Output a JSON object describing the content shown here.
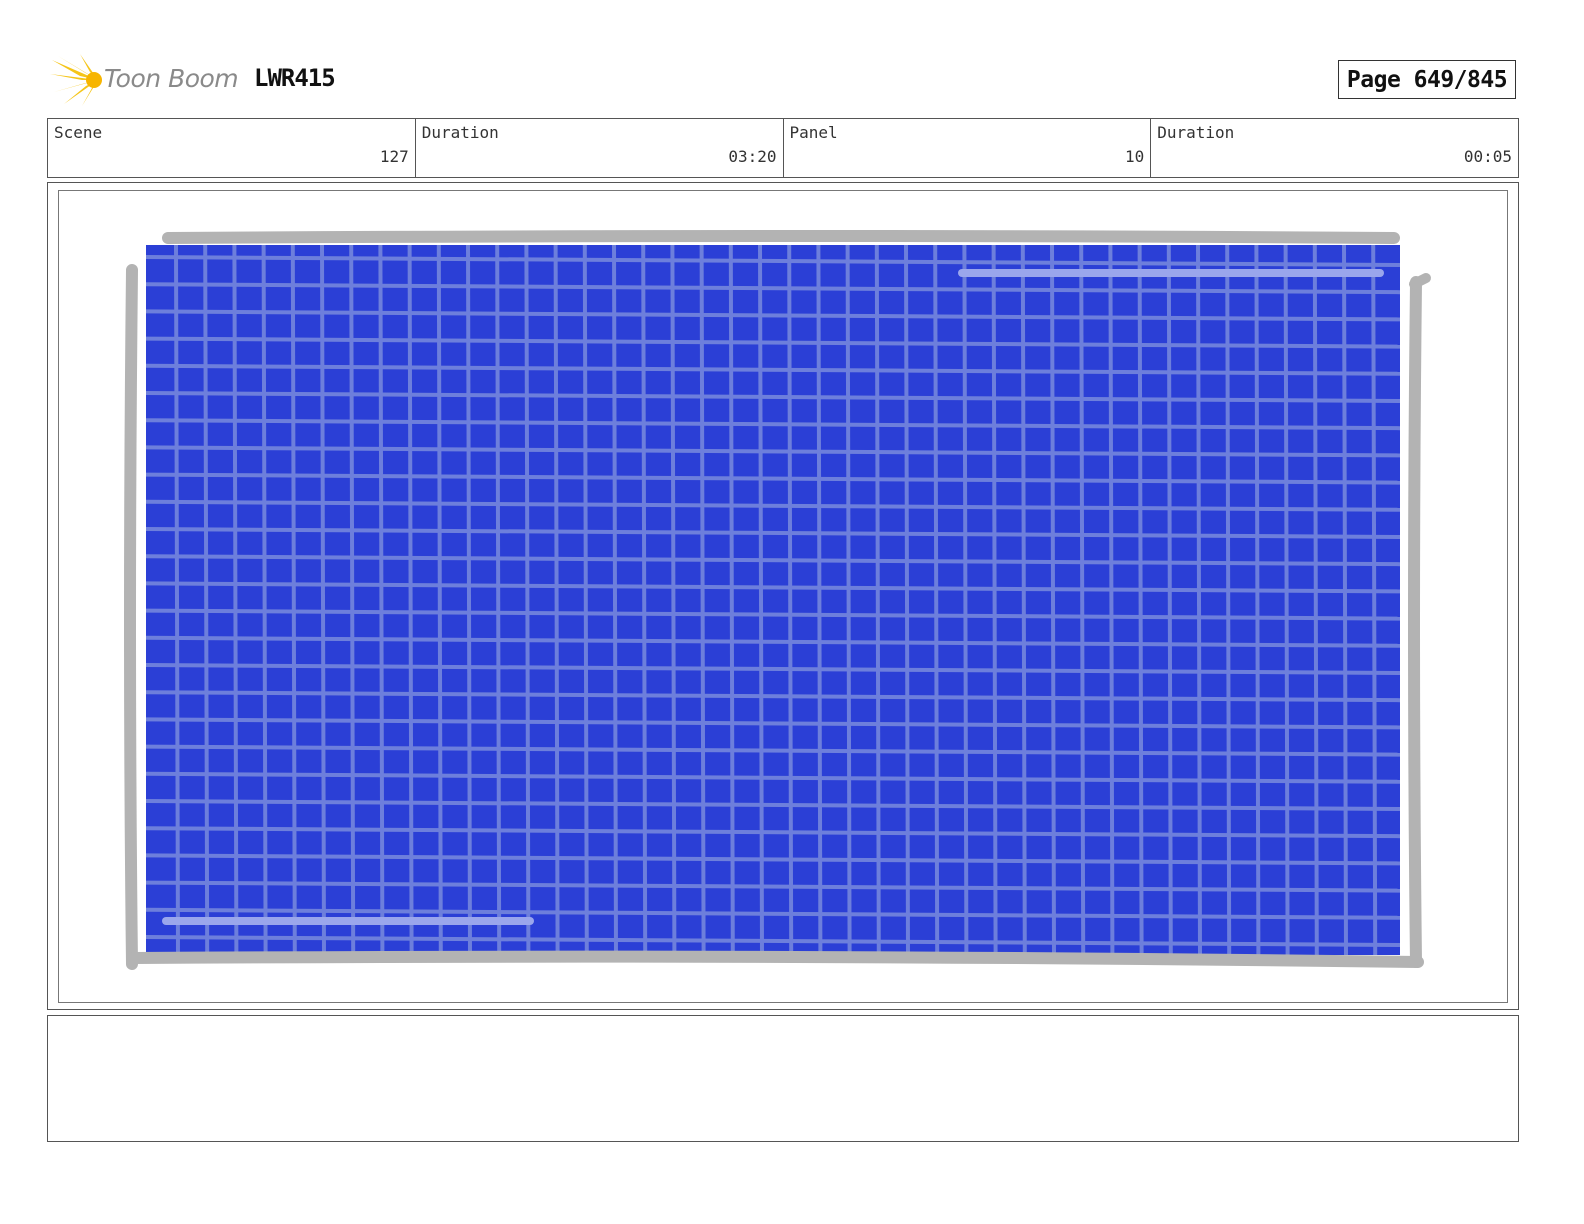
{
  "header": {
    "logo_text": "Toon Boom",
    "project_id": "LWR415",
    "page_label": "Page 649/845"
  },
  "info": {
    "scene_label": "Scene",
    "scene_value": "127",
    "scene_duration_label": "Duration",
    "scene_duration_value": "03:20",
    "panel_label": "Panel",
    "panel_value": "10",
    "panel_duration_label": "Duration",
    "panel_duration_value": "00:05"
  },
  "colors": {
    "panel_fill": "#2b3fd6",
    "grid_lines": "#6d7fdc",
    "frame_stroke": "#b3b3b3",
    "logo_accent": "#f5c518"
  },
  "notes": {
    "text": ""
  }
}
